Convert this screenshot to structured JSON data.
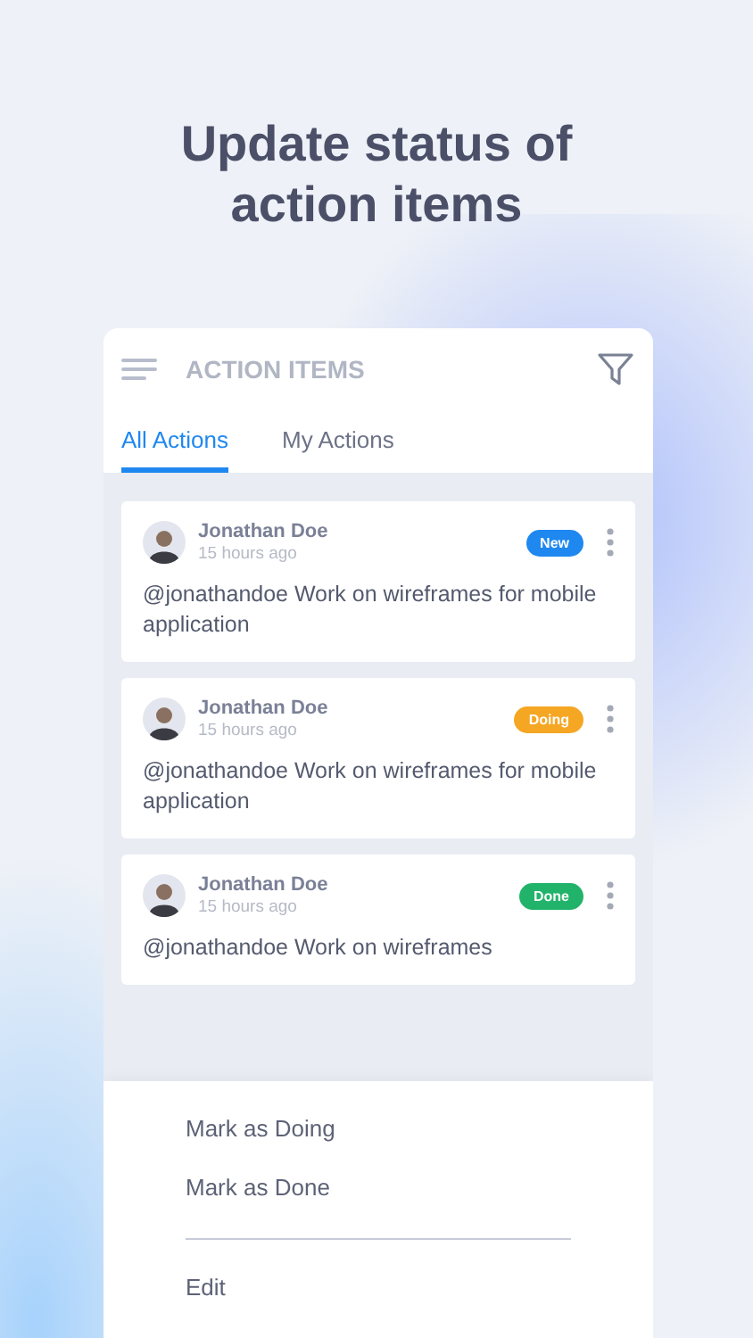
{
  "headline": "Update status of action items",
  "app_bar": {
    "title": "ACTION ITEMS"
  },
  "tabs": [
    {
      "label": "All Actions",
      "selected": true
    },
    {
      "label": "My Actions",
      "selected": false
    }
  ],
  "items": [
    {
      "author": "Jonathan Doe",
      "time": "15 hours ago",
      "status": "New",
      "color": "#1e88f0",
      "text": "@jonathandoe Work on wireframes for mobile application"
    },
    {
      "author": "Jonathan Doe",
      "time": "15 hours ago",
      "status": "Doing",
      "color": "#f5a623",
      "text": "@jonathandoe Work on wireframes for mobile application"
    },
    {
      "author": "Jonathan Doe",
      "time": "15 hours ago",
      "status": "Done",
      "color": "#22b36b",
      "text": "@jonathandoe Work on wireframes"
    }
  ],
  "sheet": {
    "actions": [
      "Mark as Doing",
      "Mark as Done"
    ],
    "secondary_actions": [
      "Edit"
    ]
  }
}
